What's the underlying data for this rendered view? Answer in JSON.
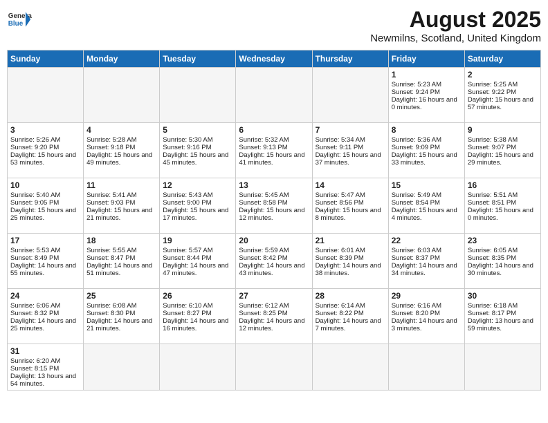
{
  "header": {
    "logo_text_general": "General",
    "logo_text_blue": "Blue",
    "month": "August 2025",
    "location": "Newmilns, Scotland, United Kingdom"
  },
  "days_of_week": [
    "Sunday",
    "Monday",
    "Tuesday",
    "Wednesday",
    "Thursday",
    "Friday",
    "Saturday"
  ],
  "weeks": [
    [
      {
        "day": "",
        "info": ""
      },
      {
        "day": "",
        "info": ""
      },
      {
        "day": "",
        "info": ""
      },
      {
        "day": "",
        "info": ""
      },
      {
        "day": "",
        "info": ""
      },
      {
        "day": "1",
        "info": "Sunrise: 5:23 AM\nSunset: 9:24 PM\nDaylight: 16 hours and 0 minutes."
      },
      {
        "day": "2",
        "info": "Sunrise: 5:25 AM\nSunset: 9:22 PM\nDaylight: 15 hours and 57 minutes."
      }
    ],
    [
      {
        "day": "3",
        "info": "Sunrise: 5:26 AM\nSunset: 9:20 PM\nDaylight: 15 hours and 53 minutes."
      },
      {
        "day": "4",
        "info": "Sunrise: 5:28 AM\nSunset: 9:18 PM\nDaylight: 15 hours and 49 minutes."
      },
      {
        "day": "5",
        "info": "Sunrise: 5:30 AM\nSunset: 9:16 PM\nDaylight: 15 hours and 45 minutes."
      },
      {
        "day": "6",
        "info": "Sunrise: 5:32 AM\nSunset: 9:13 PM\nDaylight: 15 hours and 41 minutes."
      },
      {
        "day": "7",
        "info": "Sunrise: 5:34 AM\nSunset: 9:11 PM\nDaylight: 15 hours and 37 minutes."
      },
      {
        "day": "8",
        "info": "Sunrise: 5:36 AM\nSunset: 9:09 PM\nDaylight: 15 hours and 33 minutes."
      },
      {
        "day": "9",
        "info": "Sunrise: 5:38 AM\nSunset: 9:07 PM\nDaylight: 15 hours and 29 minutes."
      }
    ],
    [
      {
        "day": "10",
        "info": "Sunrise: 5:40 AM\nSunset: 9:05 PM\nDaylight: 15 hours and 25 minutes."
      },
      {
        "day": "11",
        "info": "Sunrise: 5:41 AM\nSunset: 9:03 PM\nDaylight: 15 hours and 21 minutes."
      },
      {
        "day": "12",
        "info": "Sunrise: 5:43 AM\nSunset: 9:00 PM\nDaylight: 15 hours and 17 minutes."
      },
      {
        "day": "13",
        "info": "Sunrise: 5:45 AM\nSunset: 8:58 PM\nDaylight: 15 hours and 12 minutes."
      },
      {
        "day": "14",
        "info": "Sunrise: 5:47 AM\nSunset: 8:56 PM\nDaylight: 15 hours and 8 minutes."
      },
      {
        "day": "15",
        "info": "Sunrise: 5:49 AM\nSunset: 8:54 PM\nDaylight: 15 hours and 4 minutes."
      },
      {
        "day": "16",
        "info": "Sunrise: 5:51 AM\nSunset: 8:51 PM\nDaylight: 15 hours and 0 minutes."
      }
    ],
    [
      {
        "day": "17",
        "info": "Sunrise: 5:53 AM\nSunset: 8:49 PM\nDaylight: 14 hours and 55 minutes."
      },
      {
        "day": "18",
        "info": "Sunrise: 5:55 AM\nSunset: 8:47 PM\nDaylight: 14 hours and 51 minutes."
      },
      {
        "day": "19",
        "info": "Sunrise: 5:57 AM\nSunset: 8:44 PM\nDaylight: 14 hours and 47 minutes."
      },
      {
        "day": "20",
        "info": "Sunrise: 5:59 AM\nSunset: 8:42 PM\nDaylight: 14 hours and 43 minutes."
      },
      {
        "day": "21",
        "info": "Sunrise: 6:01 AM\nSunset: 8:39 PM\nDaylight: 14 hours and 38 minutes."
      },
      {
        "day": "22",
        "info": "Sunrise: 6:03 AM\nSunset: 8:37 PM\nDaylight: 14 hours and 34 minutes."
      },
      {
        "day": "23",
        "info": "Sunrise: 6:05 AM\nSunset: 8:35 PM\nDaylight: 14 hours and 30 minutes."
      }
    ],
    [
      {
        "day": "24",
        "info": "Sunrise: 6:06 AM\nSunset: 8:32 PM\nDaylight: 14 hours and 25 minutes."
      },
      {
        "day": "25",
        "info": "Sunrise: 6:08 AM\nSunset: 8:30 PM\nDaylight: 14 hours and 21 minutes."
      },
      {
        "day": "26",
        "info": "Sunrise: 6:10 AM\nSunset: 8:27 PM\nDaylight: 14 hours and 16 minutes."
      },
      {
        "day": "27",
        "info": "Sunrise: 6:12 AM\nSunset: 8:25 PM\nDaylight: 14 hours and 12 minutes."
      },
      {
        "day": "28",
        "info": "Sunrise: 6:14 AM\nSunset: 8:22 PM\nDaylight: 14 hours and 7 minutes."
      },
      {
        "day": "29",
        "info": "Sunrise: 6:16 AM\nSunset: 8:20 PM\nDaylight: 14 hours and 3 minutes."
      },
      {
        "day": "30",
        "info": "Sunrise: 6:18 AM\nSunset: 8:17 PM\nDaylight: 13 hours and 59 minutes."
      }
    ],
    [
      {
        "day": "31",
        "info": "Sunrise: 6:20 AM\nSunset: 8:15 PM\nDaylight: 13 hours and 54 minutes."
      },
      {
        "day": "",
        "info": ""
      },
      {
        "day": "",
        "info": ""
      },
      {
        "day": "",
        "info": ""
      },
      {
        "day": "",
        "info": ""
      },
      {
        "day": "",
        "info": ""
      },
      {
        "day": "",
        "info": ""
      }
    ]
  ]
}
